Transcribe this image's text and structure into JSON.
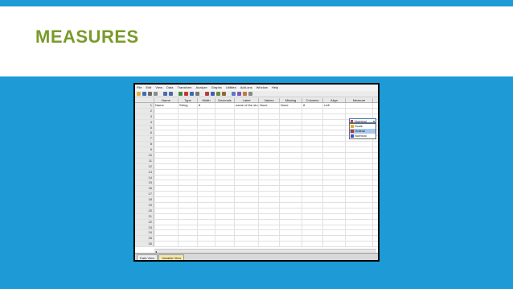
{
  "slide": {
    "title": "MEASURES"
  },
  "menubar": [
    "File",
    "Edit",
    "View",
    "Data",
    "Transform",
    "Analyze",
    "Graphs",
    "Utilities",
    "Add-ons",
    "Window",
    "Help"
  ],
  "grid": {
    "columns": [
      "",
      "Name",
      "Type",
      "Width",
      "Decimals",
      "Label",
      "Values",
      "Missing",
      "Columns",
      "Align",
      "Measure"
    ],
    "rows": [
      [
        "1",
        "Name",
        "String",
        "8",
        "",
        "name of the stu...",
        "None",
        "None",
        "8",
        "Left",
        ""
      ]
    ],
    "empty_row_numbers": [
      "2",
      "3",
      "4",
      "5",
      "6",
      "7",
      "8",
      "9",
      "10",
      "11",
      "12",
      "13",
      "14",
      "15",
      "16",
      "17",
      "18",
      "19",
      "20",
      "21",
      "22",
      "23",
      "24",
      "25",
      "26"
    ]
  },
  "measure_dropdown": {
    "selected": "Nominal",
    "options": [
      "Scale",
      "Ordinal",
      "Nominal"
    ],
    "highlighted": "Ordinal"
  },
  "tabs": [
    {
      "label": "Data View",
      "active": false
    },
    {
      "label": "Variable View",
      "active": true
    }
  ],
  "colors": {
    "background": "#1e9ad6",
    "title": "#7a9a2a",
    "active_tab": "#f7e9a8",
    "highlight": "#a8c8ee"
  }
}
